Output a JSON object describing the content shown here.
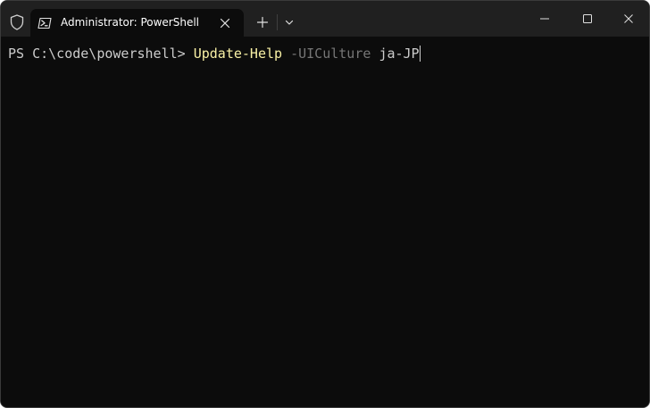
{
  "window": {
    "tab_title": "Administrator: PowerShell",
    "icons": {
      "shield": "shield-icon",
      "tab": "powershell-icon",
      "close_tab": "close-icon",
      "new_tab": "plus-icon",
      "dropdown": "chevron-down-icon",
      "minimize": "minimize-icon",
      "maximize": "maximize-icon",
      "close": "close-icon"
    }
  },
  "terminal": {
    "prompt": "PS C:\\code\\powershell> ",
    "cmdlet": "Update-Help",
    "parameter": "-UICulture",
    "argument": "ja-JP",
    "colors": {
      "background": "#0c0c0c",
      "prompt": "#cccccc",
      "cmdlet": "#f9f1a5",
      "parameter": "#767676",
      "argument": "#cccccc"
    }
  }
}
